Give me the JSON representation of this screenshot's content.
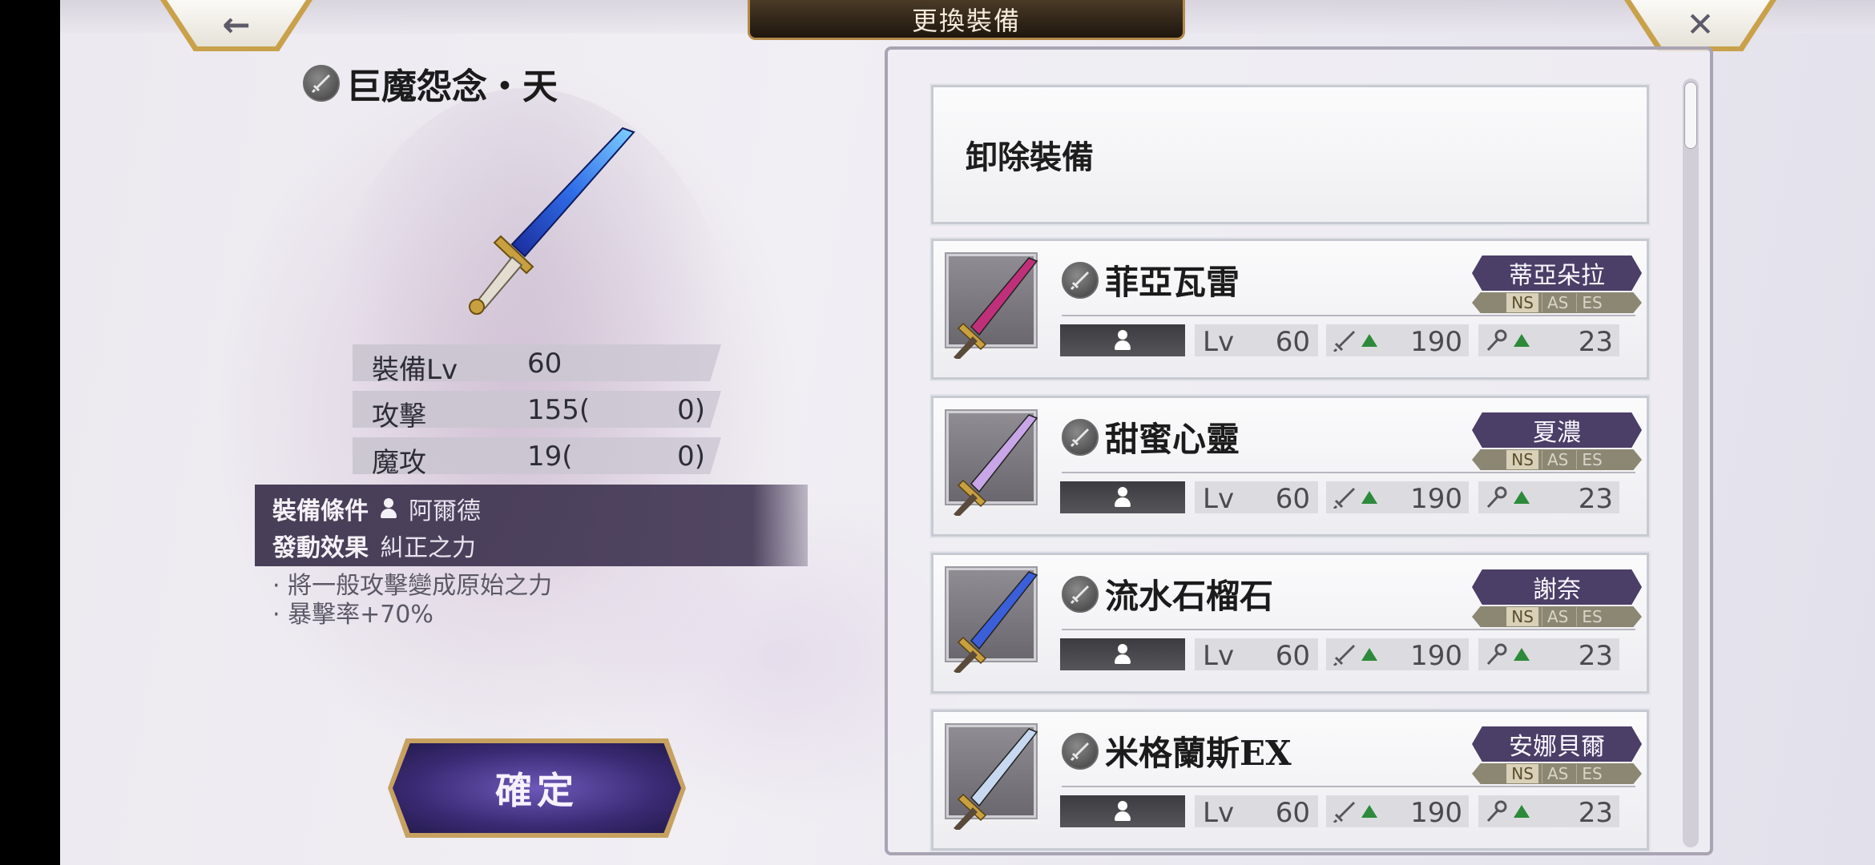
{
  "header": {
    "title": "更換裝備",
    "back_glyph": "←",
    "close_glyph": "✕"
  },
  "selected": {
    "name": "巨魔怨念・天",
    "stats": [
      {
        "label": "裝備Lv",
        "value": "60"
      },
      {
        "label": "攻擊",
        "value": "155(",
        "bonus": "0)"
      },
      {
        "label": "魔攻",
        "value": "19(",
        "bonus": "0)"
      }
    ],
    "condition_label": "裝備條件",
    "condition_value": "阿爾德",
    "effect_label": "發動效果",
    "effect_value": "糾正之力",
    "effects": [
      "· 將一般攻擊變成原始之力",
      "· 暴擊率+70%"
    ]
  },
  "confirm_label": "確定",
  "unequip_label": "卸除裝備",
  "items": [
    {
      "name": "菲亞瓦雷",
      "owner": "蒂亞朵拉",
      "styles": [
        "NS",
        "AS",
        "ES"
      ],
      "lv_label": "Lv",
      "lv": "60",
      "atk": "190",
      "mag": "23",
      "color": "#c0307a"
    },
    {
      "name": "甜蜜心靈",
      "owner": "夏濃",
      "styles": [
        "NS",
        "AS",
        "ES"
      ],
      "lv_label": "Lv",
      "lv": "60",
      "atk": "190",
      "mag": "23",
      "color": "#c9a6e8"
    },
    {
      "name": "流水石榴石",
      "owner": "謝奈",
      "styles": [
        "NS",
        "AS",
        "ES"
      ],
      "lv_label": "Lv",
      "lv": "60",
      "atk": "190",
      "mag": "23",
      "color": "#3a5fd8"
    },
    {
      "name": "米格蘭斯EX",
      "owner": "安娜貝爾",
      "styles": [
        "NS",
        "AS",
        "ES"
      ],
      "lv_label": "Lv",
      "lv": "60",
      "atk": "190",
      "mag": "23",
      "color": "#c8d8f0"
    }
  ],
  "colors": {
    "accent_gold": "#c9a14a",
    "tag_purple": "#4b3e67",
    "condition_bg": "#3a304a"
  },
  "icons": {
    "weapon_type": "sword-icon",
    "character": "person-icon",
    "attack": "sword-stat-icon",
    "magic": "staff-stat-icon",
    "stat_up": "up-arrow-icon"
  }
}
